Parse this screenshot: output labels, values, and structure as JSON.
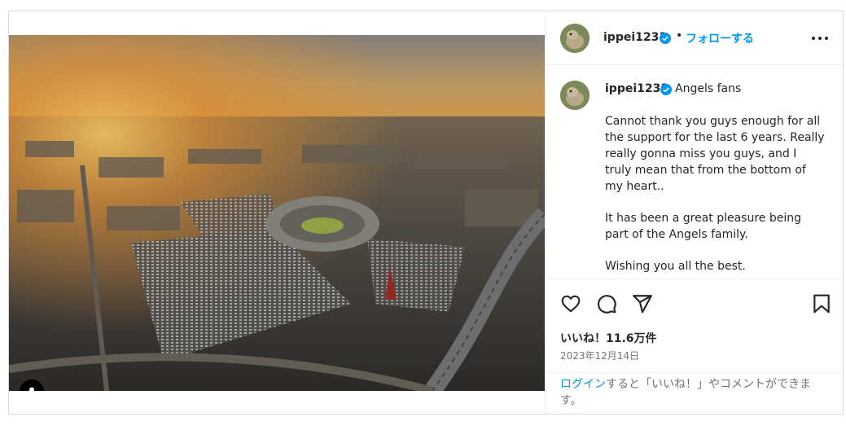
{
  "post": {
    "username": "ippei1231",
    "follow_label": "フォローする",
    "separator": "•",
    "more_label": "more options",
    "caption": {
      "first_line": "Angels fans",
      "paragraphs": [
        "Cannot thank you guys enough for all the support for the last 6 years. Really really gonna miss you guys, and I truly mean that from the bottom of my heart..",
        "It has been a great pleasure being part of the Angels family.",
        "Wishing you all the best."
      ]
    },
    "actions": {
      "icons": [
        "heart-icon",
        "comment-icon",
        "share-icon",
        "bookmark-icon"
      ]
    },
    "likes": "いいね！11.6万件",
    "date": "2023年12月14日",
    "login_prompt": {
      "link": "ログイン",
      "rest": "すると「いいね！」やコメントができます。"
    }
  },
  "colors": {
    "link_blue": "#0095f6",
    "text": "#262626",
    "muted": "#737373",
    "border": "#dbdbdb",
    "verified": "#0095f6"
  }
}
